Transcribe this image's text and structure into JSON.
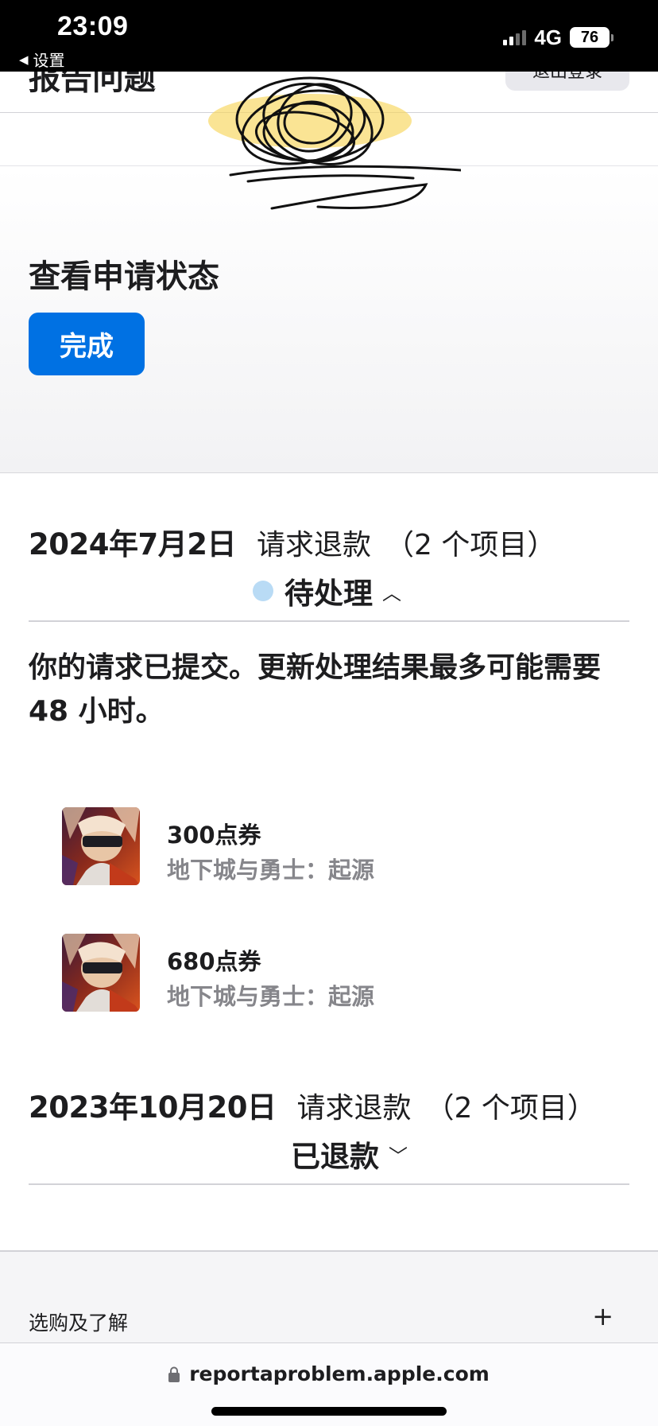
{
  "status_bar": {
    "time": "23:09",
    "back_label": "设置",
    "network": "4G",
    "battery": "76",
    "icons": [
      "back-triangle-icon",
      "cellular-signal-icon",
      "battery-icon"
    ]
  },
  "header": {
    "title": "报告问题",
    "signout_label": "退出登录"
  },
  "hero": {
    "title": "查看申请状态",
    "done_label": "完成"
  },
  "requests": [
    {
      "date": "2024年7月2日",
      "type": "请求退款",
      "count": "（2 个项目）",
      "status": "待处理",
      "status_dot_color": "#b9dbf5",
      "expanded": true,
      "message": "你的请求已提交。更新处理结果最多可能需要 48 小时。",
      "items": [
        {
          "name": "300点券",
          "app": "地下城与勇士：起源"
        },
        {
          "name": "680点券",
          "app": "地下城与勇士：起源"
        }
      ]
    },
    {
      "date": "2023年10月20日",
      "type": "请求退款",
      "count": "（2 个项目）",
      "status": "已退款",
      "expanded": false
    }
  ],
  "footer": {
    "section_label": "选购及了解",
    "expand_symbol": "+"
  },
  "url_bar": {
    "url": "reportaproblem.apple.com"
  },
  "colors": {
    "accent": "#0071e3",
    "secondary_text": "#86868b",
    "pending_dot": "#b9dbf5"
  }
}
